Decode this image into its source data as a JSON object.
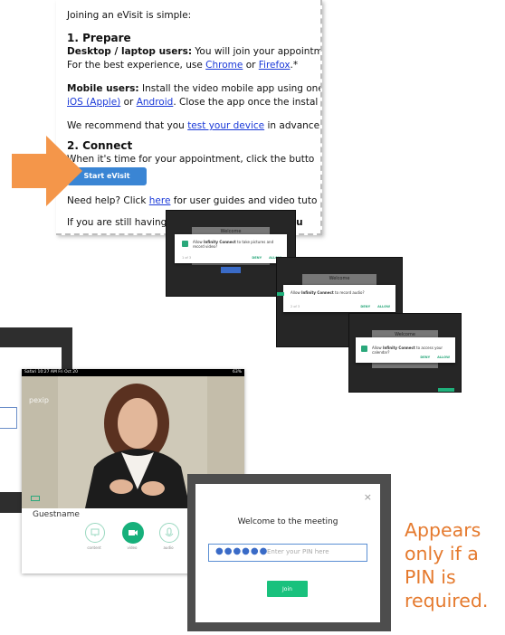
{
  "document": {
    "intro": "Joining an eVisit is simple:",
    "step1_heading": "1. Prepare",
    "desktop_bold": "Desktop / laptop users:",
    "desktop_text": " You will join your appointme",
    "best_exp": "For the best experience, use ",
    "chrome": "Chrome",
    "or1": " or ",
    "firefox": "Firefox",
    "star": ".*",
    "mobile_bold": "Mobile users:",
    "mobile_text": " Install the video mobile app using one",
    "ios": "iOS (Apple)",
    "or2": " or ",
    "android": "Android",
    "close_text": ". Close the app once the instal",
    "recommend": "We recommend that you ",
    "test_link": "test your device",
    "in_advance": " in advance",
    "step2_heading": "2. Connect",
    "connect_text": "When it's time for your appointment, click the butto",
    "start_button": "Start eVisit",
    "help_text": "Need help? Click ",
    "here_link": "here",
    "help_rest": " for user guides and video tuto",
    "still_having": "If you are still having",
    "tn_support": "TN Su"
  },
  "permissions": [
    {
      "welcome": "Welcome",
      "msg_pre": "Allow ",
      "app": "Infinity Connect",
      "msg_post": " to take pictures and record video?",
      "count": "1 of 3",
      "deny": "DENY",
      "allow": "ALLOW"
    },
    {
      "welcome": "Welcome",
      "msg_pre": "Allow ",
      "app": "Infinity Connect",
      "msg_post": " to record audio?",
      "count": "2 of 3",
      "deny": "DENY",
      "allow": "ALLOW"
    },
    {
      "welcome": "Welcome",
      "msg_pre": "Allow ",
      "app": "Infinity Connect",
      "msg_post": " to access your calendar?",
      "count": "",
      "deny": "DENY",
      "allow": "ALLOW"
    }
  ],
  "tablet": {
    "status_left": "Safari 10:27 AM Fri Oct 20",
    "status_right": "63%",
    "brand": "pexip",
    "guest_name": "Guestname",
    "controls": [
      "content",
      "video",
      "audio"
    ]
  },
  "pin_dialog": {
    "close": "×",
    "title": "Welcome to the meeting",
    "pin_dots": "●●●●●●",
    "placeholder": "Enter your PIN here",
    "join": "Join"
  },
  "annotation": {
    "lines": [
      "Appears",
      "only if a",
      "PIN is",
      "required."
    ],
    "color": "#e57a2e"
  },
  "colors": {
    "link": "#1a39d8",
    "start_button": "#3a85d4",
    "join_button": "#19c17d",
    "arrow": "#f4964a"
  }
}
